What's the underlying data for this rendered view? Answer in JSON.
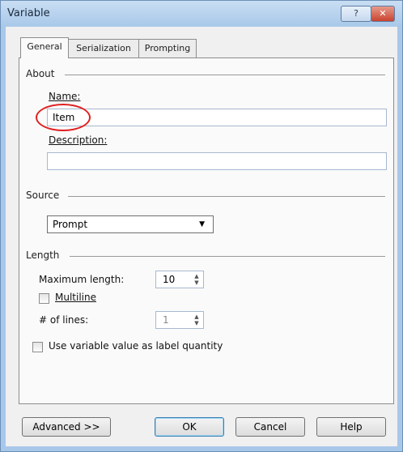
{
  "window": {
    "title": "Variable",
    "help_glyph": "?",
    "close_glyph": "✕"
  },
  "tabs": [
    {
      "label": "General",
      "active": true
    },
    {
      "label": "Serialization",
      "active": false
    },
    {
      "label": "Prompting",
      "active": false
    }
  ],
  "about": {
    "group_label": "About",
    "name_label": "Name:",
    "name_value": "Item",
    "description_label": "Description:",
    "description_value": ""
  },
  "source": {
    "group_label": "Source",
    "selected": "Prompt"
  },
  "length": {
    "group_label": "Length",
    "max_length_label": "Maximum length:",
    "max_length_value": "10",
    "multiline_label": "Multiline",
    "multiline_checked": false,
    "lines_label": "# of lines:",
    "lines_value": "1"
  },
  "label_quantity": {
    "label": "Use variable value as label quantity",
    "checked": false
  },
  "buttons": {
    "advanced": "Advanced >>",
    "ok": "OK",
    "cancel": "Cancel",
    "help": "Help"
  },
  "colors": {
    "highlight_circle": "#e02020",
    "frame": "#a8c8ea"
  }
}
